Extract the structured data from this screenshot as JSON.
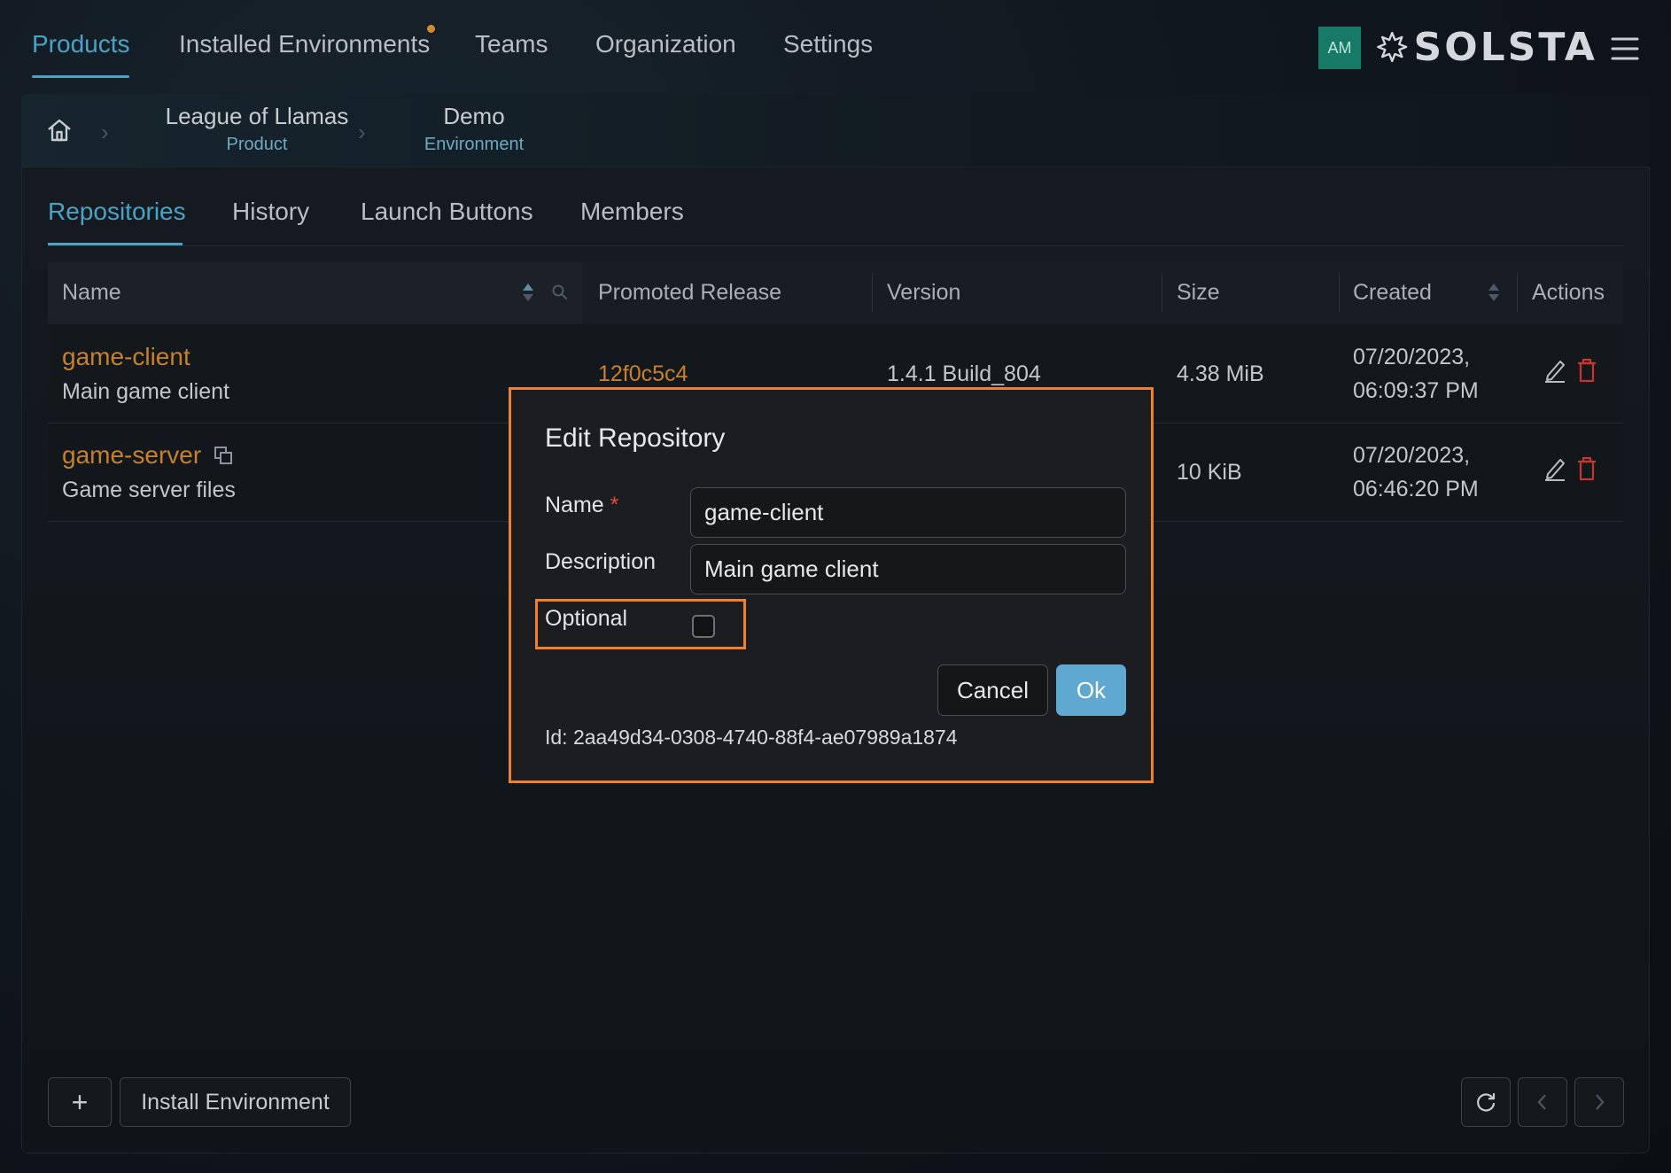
{
  "nav": {
    "tabs": [
      "Products",
      "Installed Environments",
      "Teams",
      "Organization",
      "Settings"
    ],
    "active_tab": "Products",
    "avatar_initials": "AM",
    "brand": "SOLSTA",
    "menu_icon": "hamburger-icon"
  },
  "breadcrumb": {
    "home_icon": "home-icon",
    "items": [
      {
        "title": "League of Llamas",
        "subtitle": "Product"
      },
      {
        "title": "Demo",
        "subtitle": "Environment"
      }
    ]
  },
  "subtabs": {
    "items": [
      "Repositories",
      "History",
      "Launch Buttons",
      "Members"
    ],
    "active": "Repositories"
  },
  "table": {
    "headers": [
      "Name",
      "Promoted Release",
      "Version",
      "Size",
      "Created",
      "Actions"
    ],
    "rows": [
      {
        "name": "game-client",
        "description": "Main game client",
        "promoted_release": "12f0c5c4",
        "version": "1.4.1 Build_804",
        "size": "4.38 MiB",
        "created_date": "07/20/2023,",
        "created_time": "06:09:37 PM"
      },
      {
        "name": "game-server",
        "description": "Game server files",
        "promoted_release": "",
        "version": "",
        "size": "10 KiB",
        "created_date": "07/20/2023,",
        "created_time": "06:46:20 PM"
      }
    ]
  },
  "footer": {
    "add_label": "+",
    "install_label": "Install Environment"
  },
  "modal": {
    "title": "Edit Repository",
    "name_label": "Name",
    "required_mark": "*",
    "name_value": "game-client",
    "description_label": "Description",
    "description_value": "Main game client",
    "optional_label": "Optional",
    "optional_checked": false,
    "cancel_label": "Cancel",
    "ok_label": "Ok",
    "id_text": "Id: 2aa49d34-0308-4740-88f4-ae07989a1874"
  },
  "colors": {
    "accent": "#4aa3c6",
    "link": "#c97f2b",
    "highlight": "#f0802c",
    "danger": "#c8342e",
    "ok_button": "#5fa8cf"
  }
}
